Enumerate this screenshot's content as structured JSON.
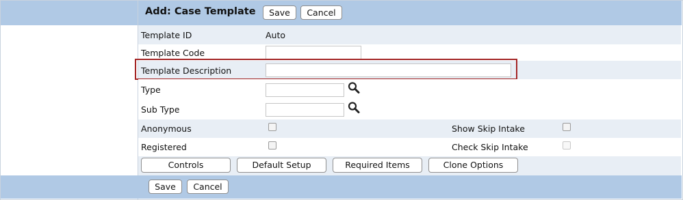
{
  "header": {
    "title": "Add: Case Template",
    "save_label": "Save",
    "cancel_label": "Cancel"
  },
  "form": {
    "template_id": {
      "label": "Template ID",
      "value": "Auto"
    },
    "template_code": {
      "label": "Template Code",
      "value": ""
    },
    "template_description": {
      "label": "Template Description",
      "value": ""
    },
    "type": {
      "label": "Type",
      "value": ""
    },
    "sub_type": {
      "label": "Sub Type",
      "value": ""
    },
    "anonymous": {
      "label": "Anonymous",
      "checked": false
    },
    "registered": {
      "label": "Registered",
      "checked": false
    },
    "show_skip_intake": {
      "label": "Show Skip Intake",
      "checked": false
    },
    "check_skip_intake": {
      "label": "Check Skip Intake",
      "checked": false,
      "disabled": true
    }
  },
  "actions": {
    "controls": "Controls",
    "default_setup": "Default Setup",
    "required_items": "Required Items",
    "clone_options": "Clone Options"
  },
  "footer": {
    "save_label": "Save",
    "cancel_label": "Cancel"
  },
  "icons": {
    "type_lookup": "magnifier-icon",
    "sub_type_lookup": "magnifier-icon"
  },
  "colors": {
    "bar": "#b0c9e5",
    "alt_row": "#e8eef5",
    "highlight": "#a32424"
  }
}
